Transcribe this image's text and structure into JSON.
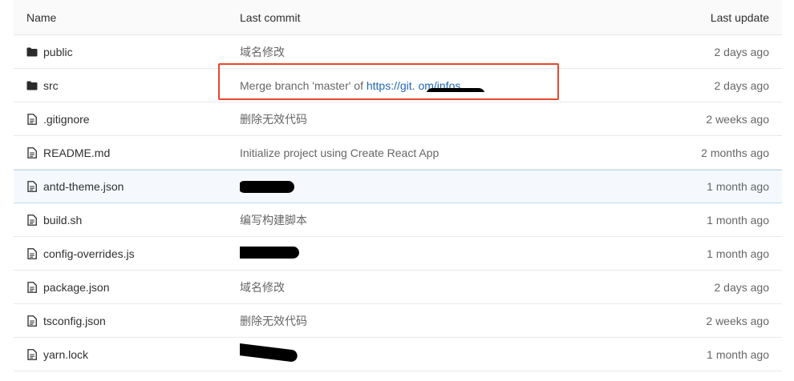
{
  "table": {
    "headers": {
      "name": "Name",
      "last_commit": "Last commit",
      "last_update": "Last update"
    },
    "rows": [
      {
        "type": "folder",
        "icon": "folder-icon",
        "name": "public",
        "commit": "域名修改",
        "commit_link": "",
        "updated": "2 days ago"
      },
      {
        "type": "folder",
        "icon": "folder-icon",
        "name": "src",
        "commit": "Merge branch 'master' of ",
        "commit_link": "https://git.          om/infos…",
        "updated": "2 days ago"
      },
      {
        "type": "file",
        "icon": "file-icon",
        "name": ".gitignore",
        "commit": "删除无效代码",
        "commit_link": "",
        "updated": "2 weeks ago"
      },
      {
        "type": "file",
        "icon": "file-icon",
        "name": "README.md",
        "commit": "Initialize project using Create React App",
        "commit_link": "",
        "updated": "2 months ago"
      },
      {
        "type": "file",
        "icon": "file-icon",
        "name": "antd-theme.json",
        "commit": "",
        "commit_link": "",
        "updated": "1 month ago"
      },
      {
        "type": "file",
        "icon": "file-icon",
        "name": "build.sh",
        "commit": "编写构建脚本",
        "commit_link": "",
        "updated": "1 month ago"
      },
      {
        "type": "file",
        "icon": "file-icon",
        "name": "config-overrides.js",
        "commit": "",
        "commit_link": "",
        "updated": "1 month ago"
      },
      {
        "type": "file",
        "icon": "file-icon",
        "name": "package.json",
        "commit": "域名修改",
        "commit_link": "",
        "updated": "2 days ago"
      },
      {
        "type": "file",
        "icon": "file-icon",
        "name": "tsconfig.json",
        "commit": "删除无效代码",
        "commit_link": "",
        "updated": "2 weeks ago"
      },
      {
        "type": "file",
        "icon": "file-icon",
        "name": "yarn.lock",
        "commit": "",
        "commit_link": "",
        "updated": "1 month ago"
      }
    ]
  },
  "colors": {
    "link": "#1f67b6",
    "highlight_row_bg": "#f5f9fd",
    "annotation_box": "#e8472e"
  }
}
